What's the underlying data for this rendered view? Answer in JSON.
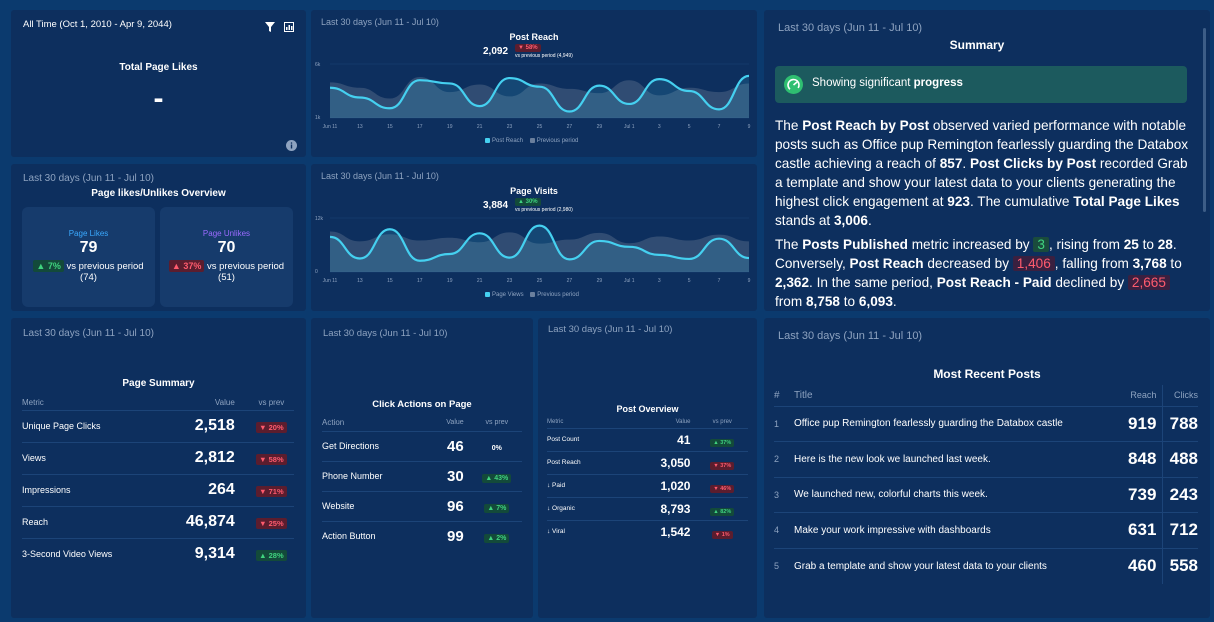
{
  "colors": {
    "bg": "#0b3a6e",
    "card": "#0d2f5e",
    "accent": "#45d0f0",
    "up": "#3fd37f",
    "down": "#ff5b6e",
    "page_likes": "#3aa9ff",
    "page_unlikes": "#9b6bff"
  },
  "total_likes": {
    "period": "All Time (Oct 1, 2010 - Apr 9, 2044)",
    "title": "Total Page Likes",
    "value": "-",
    "filter_icon": "filter-icon",
    "chart_icon": "chart-icon",
    "info_icon": "info-icon"
  },
  "likes_overview": {
    "period": "Last 30 days (Jun 11 - Jul 10)",
    "title": "Page likes/Unlikes Overview",
    "likes": {
      "label": "Page Likes",
      "value": "79",
      "change": "▲ 7%",
      "vs": "vs previous period",
      "prev": "(74)"
    },
    "unlikes": {
      "label": "Page Unlikes",
      "value": "70",
      "change": "▲ 37%",
      "vs": "vs previous period",
      "prev": "(51)"
    }
  },
  "post_reach_chart": {
    "period": "Last 30 days (Jun 11 - Jul 10)",
    "title": "Post Reach",
    "value": "2,092",
    "change": "▼ 58%",
    "vs": "vs previous period (4,949)",
    "legend_current": "Post Reach",
    "legend_previous": "Previous period"
  },
  "page_visits_chart": {
    "period": "Last 30 days (Jun 11 - Jul 10)",
    "title": "Page Visits",
    "value": "3,884",
    "change": "▲ 30%",
    "vs": "vs previous period (2,980)",
    "legend_current": "Page Views",
    "legend_previous": "Previous period"
  },
  "chart_data": [
    {
      "type": "area",
      "title": "Post Reach",
      "x": [
        "Jun 11",
        "13",
        "15",
        "17",
        "19",
        "21",
        "23",
        "25",
        "27",
        "29",
        "Jul 1",
        "3",
        "5",
        "7",
        "9"
      ],
      "y_ticks": [
        "6k",
        "1k"
      ],
      "ylim": [
        1000,
        6000
      ],
      "legend": "bottom",
      "series": [
        {
          "name": "Post Reach",
          "values": [
            3800,
            2900,
            1900,
            4500,
            4200,
            2100,
            4700,
            3900,
            1600,
            4000,
            2300,
            4600,
            3500,
            1800,
            4900
          ]
        },
        {
          "name": "Previous period",
          "values": [
            4300,
            3800,
            2800,
            4800,
            3400,
            4100,
            3000,
            4200,
            3700,
            3300,
            4500,
            3100,
            3800,
            3400,
            4200
          ]
        }
      ]
    },
    {
      "type": "area",
      "title": "Page Visits",
      "x": [
        "Jun 11",
        "13",
        "15",
        "17",
        "19",
        "21",
        "23",
        "25",
        "27",
        "29",
        "Jul 1",
        "3",
        "5",
        "7",
        "9"
      ],
      "y_ticks": [
        "12k",
        "0"
      ],
      "ylim": [
        0,
        12000
      ],
      "legend": "bottom",
      "series": [
        {
          "name": "Page Views",
          "values": [
            7800,
            3000,
            9500,
            2500,
            4000,
            8600,
            3200,
            10300,
            2800,
            6900,
            5600,
            3800,
            2900,
            7400,
            3100
          ]
        },
        {
          "name": "Previous period",
          "values": [
            9000,
            6800,
            8400,
            7000,
            7600,
            6600,
            8800,
            6300,
            7200,
            8700,
            6400,
            7900,
            7000,
            8300,
            6800
          ]
        }
      ]
    }
  ],
  "summary": {
    "period": "Last 30 days (Jun 11 - Jul 10)",
    "title": "Summary",
    "banner_pre": "Showing significant ",
    "banner_bold": "progress",
    "banner_icon": "gauge-icon",
    "p1": [
      {
        "t": "The "
      },
      {
        "t": "Post Reach by Post",
        "b": true
      },
      {
        "t": " observed varied performance with notable posts such as Office pup Remington fearlessly guarding the Databox castle achieving a reach of "
      },
      {
        "t": "857",
        "b": true
      },
      {
        "t": ". "
      },
      {
        "t": "Post Clicks by Post",
        "b": true
      },
      {
        "t": " recorded Grab a template and show your latest data to your clients generating the highest click engagement at "
      },
      {
        "t": "923",
        "b": true
      },
      {
        "t": ". The cumulative "
      },
      {
        "t": "Total Page Likes",
        "b": true
      },
      {
        "t": " stands at "
      },
      {
        "t": "3,006",
        "b": true
      },
      {
        "t": "."
      }
    ],
    "p2": [
      {
        "t": "The "
      },
      {
        "t": "Posts Published",
        "b": true
      },
      {
        "t": " metric increased by "
      },
      {
        "t": "3",
        "u": true
      },
      {
        "t": ", rising from "
      },
      {
        "t": "25",
        "b": true
      },
      {
        "t": " to "
      },
      {
        "t": "28",
        "b": true
      },
      {
        "t": ". Conversely, "
      },
      {
        "t": "Post Reach",
        "b": true
      },
      {
        "t": " decreased by "
      },
      {
        "t": "1,406",
        "d": true
      },
      {
        "t": ", falling from "
      },
      {
        "t": "3,768",
        "b": true
      },
      {
        "t": " to "
      },
      {
        "t": "2,362",
        "b": true
      },
      {
        "t": ". In the same period, "
      },
      {
        "t": "Post Reach - Paid",
        "b": true
      },
      {
        "t": " declined by "
      },
      {
        "t": "2,665",
        "d": true
      },
      {
        "t": " from "
      },
      {
        "t": "8,758",
        "b": true
      },
      {
        "t": " to "
      },
      {
        "t": "6,093",
        "b": true
      },
      {
        "t": "."
      }
    ]
  },
  "page_summary": {
    "period": "Last 30 days (Jun 11 - Jul 10)",
    "title": "Page Summary",
    "headers": [
      "Metric",
      "Value",
      "vs prev"
    ],
    "rows": [
      {
        "metric": "Unique Page Clicks",
        "value": "2,518",
        "change": "▼ 20%",
        "dir": "down"
      },
      {
        "metric": "Views",
        "value": "2,812",
        "change": "▼ 58%",
        "dir": "down"
      },
      {
        "metric": "Impressions",
        "value": "264",
        "change": "▼ 71%",
        "dir": "down"
      },
      {
        "metric": "Reach",
        "value": "46,874",
        "change": "▼ 25%",
        "dir": "down"
      },
      {
        "metric": "3-Second Video Views",
        "value": "9,314",
        "change": "▲ 28%",
        "dir": "up"
      }
    ]
  },
  "click_actions": {
    "period": "Last 30 days (Jun 11 - Jul 10)",
    "title": "Click Actions on Page",
    "headers": [
      "Action",
      "Value",
      "vs prev"
    ],
    "rows": [
      {
        "metric": "Get Directions",
        "value": "46",
        "change": "0%",
        "dir": "flat"
      },
      {
        "metric": "Phone Number",
        "value": "30",
        "change": "▲ 43%",
        "dir": "up"
      },
      {
        "metric": "Website",
        "value": "96",
        "change": "▲ 7%",
        "dir": "up"
      },
      {
        "metric": "Action Button",
        "value": "99",
        "change": "▲ 2%",
        "dir": "up"
      }
    ]
  },
  "post_overview": {
    "period": "Last 30 days (Jun 11 - Jul 10)",
    "title": "Post Overview",
    "headers": [
      "Metric",
      "Value",
      "vs prev"
    ],
    "rows": [
      {
        "metric": "Post Count",
        "value": "41",
        "change": "▲ 37%",
        "dir": "up"
      },
      {
        "metric": "Post Reach",
        "value": "3,050",
        "change": "▼ 37%",
        "dir": "down"
      },
      {
        "metric": "↓ Paid",
        "value": "1,020",
        "change": "▼ 46%",
        "dir": "down"
      },
      {
        "metric": "↓ Organic",
        "value": "8,793",
        "change": "▲ 82%",
        "dir": "up"
      },
      {
        "metric": "↓ Viral",
        "value": "1,542",
        "change": "▼ 1%",
        "dir": "down"
      }
    ]
  },
  "recent_posts": {
    "period": "Last 30 days (Jun 11 - Jul 10)",
    "title": "Most Recent Posts",
    "headers": [
      "#",
      "Title",
      "Reach",
      "Clicks"
    ],
    "rows": [
      {
        "n": "1",
        "title": "Office pup Remington fearlessly guarding the Databox castle",
        "reach": "919",
        "clicks": "788"
      },
      {
        "n": "2",
        "title": "Here is the new look we launched last week.",
        "reach": "848",
        "clicks": "488"
      },
      {
        "n": "3",
        "title": "We launched new, colorful charts this week.",
        "reach": "739",
        "clicks": "243"
      },
      {
        "n": "4",
        "title": "Make your work impressive with dashboards",
        "reach": "631",
        "clicks": "712"
      },
      {
        "n": "5",
        "title": "Grab a template and show your latest data to your clients",
        "reach": "460",
        "clicks": "558"
      }
    ]
  }
}
